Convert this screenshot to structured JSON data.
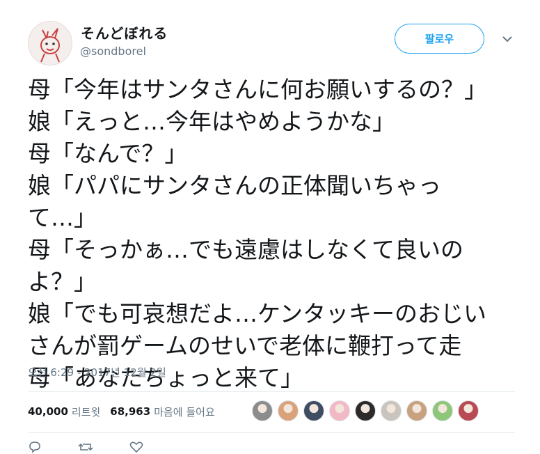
{
  "user": {
    "display_name": "そんどぼれる",
    "handle": "@sondborel",
    "avatar_icon": "avatar-drawing"
  },
  "follow_button": {
    "label": "팔로우",
    "color": "#1da1f2"
  },
  "tweet_lines": [
    "母「今年はサンタさんに何お願いするの？」",
    "娘「えっと…今年はやめようかな」",
    "母「なんで？」",
    "娘「パパにサンタさんの正体聞いちゃっ",
    "て…」",
    "母「そっかぁ…でも遠慮はしなくて良いの",
    "よ？」",
    "娘「でも可哀想だよ…ケンタッキーのおじい",
    "さんが罰ゲームのせいで老体に鞭打って走",
    "母「あなたちょっと来て」"
  ],
  "timestamp": "오전 6:29 - 2017년 12월 2일",
  "stats": {
    "retweets_count": "40,000",
    "retweets_label": "리트윗",
    "likes_count": "68,963",
    "likes_label": "마음에 들어요"
  },
  "likers": [
    {
      "icon": "liker-avatar-1",
      "color": "#8c8c8c"
    },
    {
      "icon": "liker-avatar-2",
      "color": "#d9a27a"
    },
    {
      "icon": "liker-avatar-3",
      "color": "#3f4d63"
    },
    {
      "icon": "liker-avatar-4",
      "color": "#f2b8c6"
    },
    {
      "icon": "liker-avatar-5",
      "color": "#2b2b2b"
    },
    {
      "icon": "liker-avatar-6",
      "color": "#c9c4bd"
    },
    {
      "icon": "liker-avatar-7",
      "color": "#c8a27e"
    },
    {
      "icon": "liker-avatar-8",
      "color": "#8fc77a"
    },
    {
      "icon": "liker-avatar-9",
      "color": "#b94a54"
    }
  ],
  "actions": {
    "reply_count": "",
    "retweet_count": "",
    "like_count": ""
  }
}
